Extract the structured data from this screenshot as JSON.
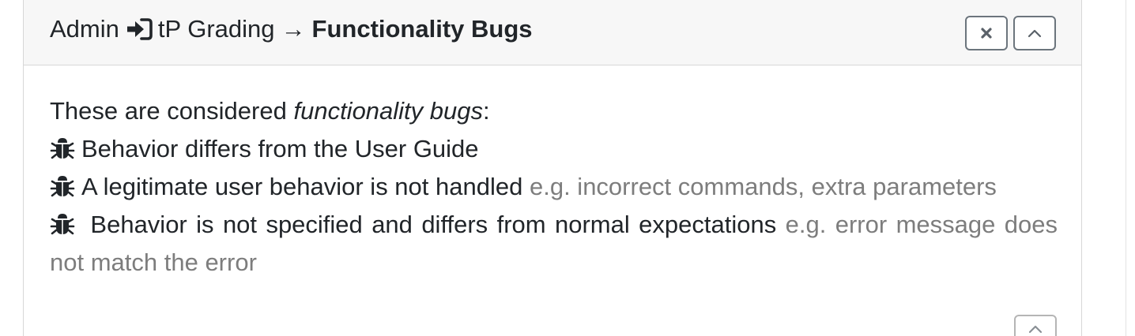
{
  "header": {
    "crumb_root": "Admin",
    "crumb_mid": "tP Grading",
    "separator": "→",
    "title": "Functionality Bugs",
    "signin_icon": "sign-in-icon",
    "close_icon": "close-icon",
    "collapse_icon": "chevron-up-icon"
  },
  "body": {
    "intro_prefix": "These are considered ",
    "intro_term": "functionality bugs",
    "intro_suffix": ":",
    "bullet_icon": "bug-icon",
    "items": [
      {
        "text": "Behavior differs from the User Guide",
        "example": ""
      },
      {
        "text": "A legitimate user behavior is not handled",
        "example": "e.g. incorrect commands, extra parameters"
      },
      {
        "text": "Behavior is not specified and differs from normal expectations",
        "example": "e.g. error message does not match the error"
      }
    ]
  },
  "footer": {
    "collapse_icon": "chevron-up-icon"
  },
  "colors": {
    "text": "#212529",
    "muted": "#7d7d7d",
    "header_bg": "#f7f7f7",
    "border": "#d7d7d7",
    "button_border": "#6c757d"
  }
}
